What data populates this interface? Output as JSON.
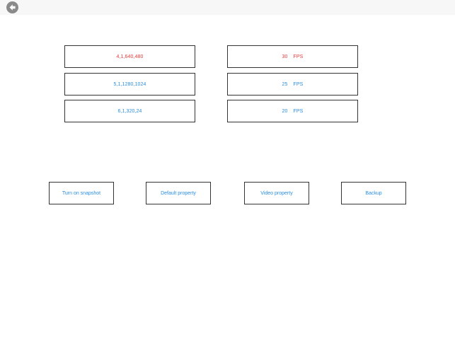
{
  "colors": {
    "selected": "#e8393a",
    "normal": "#2a8ee0"
  },
  "header": {
    "back_icon": "back-arrow-icon"
  },
  "resolutions": [
    {
      "label": "4,1,640,480",
      "selected": true
    },
    {
      "label": "5,1,1280,1024",
      "selected": false
    },
    {
      "label": "6,1,320,24",
      "selected": false
    }
  ],
  "frame_rates": [
    {
      "value": "30",
      "unit": "FPS",
      "selected": true
    },
    {
      "value": "25",
      "unit": "FPS",
      "selected": false
    },
    {
      "value": "20",
      "unit": "FPS",
      "selected": false
    }
  ],
  "actions": {
    "snapshot": "Turn on snapshot",
    "default_property": "Default property",
    "video_property": "Video property",
    "backup": "Backup"
  }
}
